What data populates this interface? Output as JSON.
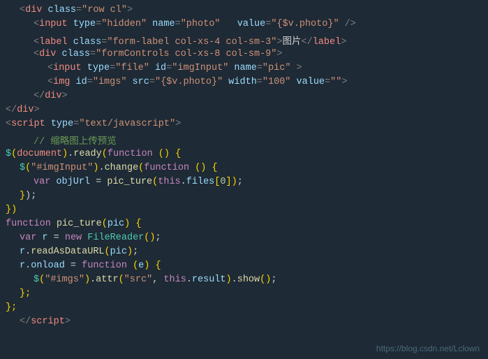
{
  "lines": [
    {
      "indent": 1,
      "tokens": [
        {
          "cls": "c-punct",
          "text": "<"
        },
        {
          "cls": "c-tagname",
          "text": "div"
        },
        {
          "cls": "c-attr",
          "text": " class"
        },
        {
          "cls": "c-punct",
          "text": "="
        },
        {
          "cls": "c-string",
          "text": "\"row cl\""
        },
        {
          "cls": "c-punct",
          "text": ">"
        }
      ]
    },
    {
      "indent": 2,
      "tokens": [
        {
          "cls": "c-punct",
          "text": "<"
        },
        {
          "cls": "c-tagname",
          "text": "input"
        },
        {
          "cls": "c-attr",
          "text": " type"
        },
        {
          "cls": "c-punct",
          "text": "="
        },
        {
          "cls": "c-string",
          "text": "\"hidden\""
        },
        {
          "cls": "c-attr",
          "text": " name"
        },
        {
          "cls": "c-punct",
          "text": "="
        },
        {
          "cls": "c-string",
          "text": "\"photo\""
        },
        {
          "cls": "c-text",
          "text": "   "
        },
        {
          "cls": "c-attr",
          "text": "value"
        },
        {
          "cls": "c-punct",
          "text": "="
        },
        {
          "cls": "c-string",
          "text": "\"{$v.photo}\""
        },
        {
          "cls": "c-text",
          "text": " "
        },
        {
          "cls": "c-punct",
          "text": "/>"
        }
      ]
    },
    {
      "indent": 2,
      "tokens": [
        {
          "cls": "c-punct",
          "text": "<"
        },
        {
          "cls": "c-tagname",
          "text": "label"
        },
        {
          "cls": "c-attr",
          "text": " class"
        },
        {
          "cls": "c-punct",
          "text": "="
        },
        {
          "cls": "c-string",
          "text": "\"form-label col-xs-4 col-sm-3\""
        },
        {
          "cls": "c-punct",
          "text": ">"
        },
        {
          "cls": "c-text",
          "text": "图片"
        },
        {
          "cls": "c-punct",
          "text": "</"
        },
        {
          "cls": "c-tagname",
          "text": "label"
        },
        {
          "cls": "c-punct",
          "text": ">"
        }
      ]
    },
    {
      "indent": 2,
      "tokens": [
        {
          "cls": "c-punct",
          "text": "<"
        },
        {
          "cls": "c-tagname",
          "text": "div"
        },
        {
          "cls": "c-attr",
          "text": " class"
        },
        {
          "cls": "c-punct",
          "text": "="
        },
        {
          "cls": "c-string",
          "text": "\"formControls col-xs-8 col-sm-9\""
        },
        {
          "cls": "c-punct",
          "text": ">"
        }
      ]
    },
    {
      "indent": 3,
      "tokens": [
        {
          "cls": "c-punct",
          "text": "<"
        },
        {
          "cls": "c-tagname",
          "text": "input"
        },
        {
          "cls": "c-attr",
          "text": " type"
        },
        {
          "cls": "c-punct",
          "text": "="
        },
        {
          "cls": "c-string",
          "text": "\"file\""
        },
        {
          "cls": "c-attr",
          "text": " id"
        },
        {
          "cls": "c-punct",
          "text": "="
        },
        {
          "cls": "c-string",
          "text": "\"imgInput\""
        },
        {
          "cls": "c-attr",
          "text": " name"
        },
        {
          "cls": "c-punct",
          "text": "="
        },
        {
          "cls": "c-string",
          "text": "\"pic\""
        },
        {
          "cls": "c-text",
          "text": " "
        },
        {
          "cls": "c-punct",
          "text": ">"
        }
      ]
    },
    {
      "indent": 3,
      "tokens": [
        {
          "cls": "c-punct",
          "text": "<"
        },
        {
          "cls": "c-tagname",
          "text": "img"
        },
        {
          "cls": "c-attr",
          "text": " id"
        },
        {
          "cls": "c-punct",
          "text": "="
        },
        {
          "cls": "c-string",
          "text": "\"imgs\""
        },
        {
          "cls": "c-attr",
          "text": " src"
        },
        {
          "cls": "c-punct",
          "text": "="
        },
        {
          "cls": "c-string",
          "text": "\"{$v.photo}\""
        },
        {
          "cls": "c-attr",
          "text": " width"
        },
        {
          "cls": "c-punct",
          "text": "="
        },
        {
          "cls": "c-string",
          "text": "\"100\""
        },
        {
          "cls": "c-attr",
          "text": " value"
        },
        {
          "cls": "c-punct",
          "text": "="
        },
        {
          "cls": "c-string",
          "text": "\"\""
        },
        {
          "cls": "c-punct",
          "text": ">"
        }
      ]
    },
    {
      "indent": 2,
      "tokens": [
        {
          "cls": "c-punct",
          "text": "</"
        },
        {
          "cls": "c-tagname",
          "text": "div"
        },
        {
          "cls": "c-punct",
          "text": ">"
        }
      ]
    },
    {
      "indent": 0,
      "tokens": [
        {
          "cls": "c-punct",
          "text": "</"
        },
        {
          "cls": "c-tagname",
          "text": "div"
        },
        {
          "cls": "c-punct",
          "text": ">"
        }
      ]
    },
    {
      "indent": 0,
      "tokens": [
        {
          "cls": "c-punct",
          "text": "<"
        },
        {
          "cls": "c-tagname",
          "text": "script"
        },
        {
          "cls": "c-attr",
          "text": " type"
        },
        {
          "cls": "c-punct",
          "text": "="
        },
        {
          "cls": "c-string",
          "text": "\"text/javascript\""
        },
        {
          "cls": "c-punct",
          "text": ">"
        }
      ]
    },
    {
      "indent": 2,
      "tokens": [
        {
          "cls": "c-comment",
          "text": "// 缩略图上传预览"
        }
      ]
    },
    {
      "indent": 0,
      "tokens": [
        {
          "cls": "c-dollar",
          "text": "$"
        },
        {
          "cls": "c-bracket",
          "text": "("
        },
        {
          "cls": "c-tagname",
          "text": "document"
        },
        {
          "cls": "c-bracket",
          "text": ")"
        },
        {
          "cls": "c-text",
          "text": "."
        },
        {
          "cls": "c-method",
          "text": "ready"
        },
        {
          "cls": "c-bracket",
          "text": "("
        },
        {
          "cls": "c-pink",
          "text": "function"
        },
        {
          "cls": "c-text",
          "text": " "
        },
        {
          "cls": "c-bracket",
          "text": "()"
        },
        {
          "cls": "c-text",
          "text": " "
        },
        {
          "cls": "c-bracket",
          "text": "{"
        }
      ]
    },
    {
      "indent": 1,
      "tokens": [
        {
          "cls": "c-dollar",
          "text": "$"
        },
        {
          "cls": "c-bracket",
          "text": "("
        },
        {
          "cls": "c-string",
          "text": "\"#imgInput\""
        },
        {
          "cls": "c-bracket",
          "text": ")"
        },
        {
          "cls": "c-text",
          "text": "."
        },
        {
          "cls": "c-method",
          "text": "change"
        },
        {
          "cls": "c-bracket",
          "text": "("
        },
        {
          "cls": "c-pink",
          "text": "function"
        },
        {
          "cls": "c-text",
          "text": " "
        },
        {
          "cls": "c-bracket",
          "text": "()"
        },
        {
          "cls": "c-text",
          "text": " "
        },
        {
          "cls": "c-bracket",
          "text": "{"
        }
      ]
    },
    {
      "indent": 2,
      "tokens": [
        {
          "cls": "c-pink",
          "text": "var"
        },
        {
          "cls": "c-text",
          "text": " "
        },
        {
          "cls": "c-var",
          "text": "objUrl"
        },
        {
          "cls": "c-text",
          "text": " = "
        },
        {
          "cls": "c-method",
          "text": "pic_ture"
        },
        {
          "cls": "c-bracket",
          "text": "("
        },
        {
          "cls": "c-pink",
          "text": "this"
        },
        {
          "cls": "c-text",
          "text": "."
        },
        {
          "cls": "c-var",
          "text": "files"
        },
        {
          "cls": "c-bracket",
          "text": "["
        },
        {
          "cls": "c-number",
          "text": "0"
        },
        {
          "cls": "c-bracket",
          "text": "]"
        },
        {
          "cls": "c-bracket",
          "text": ")"
        },
        {
          "cls": "c-text",
          "text": ";"
        }
      ]
    },
    {
      "indent": 1,
      "tokens": [
        {
          "cls": "c-bracket",
          "text": "}"
        },
        {
          "cls": "c-text",
          "text": ");"
        }
      ]
    },
    {
      "indent": 0,
      "tokens": [
        {
          "cls": "c-bracket",
          "text": "})"
        }
      ]
    },
    {
      "indent": 0,
      "tokens": [
        {
          "cls": "c-pink",
          "text": "function"
        },
        {
          "cls": "c-text",
          "text": " "
        },
        {
          "cls": "c-method",
          "text": "pic_ture"
        },
        {
          "cls": "c-bracket",
          "text": "("
        },
        {
          "cls": "c-var",
          "text": "pic"
        },
        {
          "cls": "c-bracket",
          "text": ")"
        },
        {
          "cls": "c-text",
          "text": " "
        },
        {
          "cls": "c-bracket",
          "text": "{"
        }
      ]
    },
    {
      "indent": 1,
      "tokens": [
        {
          "cls": "c-pink",
          "text": "var"
        },
        {
          "cls": "c-text",
          "text": " "
        },
        {
          "cls": "c-var",
          "text": "r"
        },
        {
          "cls": "c-text",
          "text": " = "
        },
        {
          "cls": "c-pink",
          "text": "new"
        },
        {
          "cls": "c-text",
          "text": " "
        },
        {
          "cls": "c-teal",
          "text": "FileReader"
        },
        {
          "cls": "c-bracket",
          "text": "()"
        },
        {
          "cls": "c-text",
          "text": ";"
        }
      ]
    },
    {
      "indent": 1,
      "tokens": [
        {
          "cls": "c-var",
          "text": "r"
        },
        {
          "cls": "c-text",
          "text": "."
        },
        {
          "cls": "c-method",
          "text": "readAsDataURL"
        },
        {
          "cls": "c-bracket",
          "text": "("
        },
        {
          "cls": "c-var",
          "text": "pic"
        },
        {
          "cls": "c-bracket",
          "text": ")"
        },
        {
          "cls": "c-text",
          "text": ";"
        }
      ]
    },
    {
      "indent": 1,
      "tokens": [
        {
          "cls": "c-var",
          "text": "r"
        },
        {
          "cls": "c-text",
          "text": "."
        },
        {
          "cls": "c-var",
          "text": "onload"
        },
        {
          "cls": "c-text",
          "text": " = "
        },
        {
          "cls": "c-pink",
          "text": "function"
        },
        {
          "cls": "c-text",
          "text": " "
        },
        {
          "cls": "c-bracket",
          "text": "("
        },
        {
          "cls": "c-var",
          "text": "e"
        },
        {
          "cls": "c-bracket",
          "text": ")"
        },
        {
          "cls": "c-text",
          "text": " "
        },
        {
          "cls": "c-bracket",
          "text": "{"
        }
      ]
    },
    {
      "indent": 2,
      "tokens": [
        {
          "cls": "c-dollar",
          "text": "$"
        },
        {
          "cls": "c-bracket",
          "text": "("
        },
        {
          "cls": "c-string",
          "text": "\"#imgs\""
        },
        {
          "cls": "c-bracket",
          "text": ")"
        },
        {
          "cls": "c-text",
          "text": "."
        },
        {
          "cls": "c-method",
          "text": "attr"
        },
        {
          "cls": "c-bracket",
          "text": "("
        },
        {
          "cls": "c-string",
          "text": "\"src\""
        },
        {
          "cls": "c-text",
          "text": ", "
        },
        {
          "cls": "c-pink",
          "text": "this"
        },
        {
          "cls": "c-text",
          "text": "."
        },
        {
          "cls": "c-var",
          "text": "result"
        },
        {
          "cls": "c-bracket",
          "text": ")"
        },
        {
          "cls": "c-text",
          "text": "."
        },
        {
          "cls": "c-method",
          "text": "show"
        },
        {
          "cls": "c-bracket",
          "text": "()"
        },
        {
          "cls": "c-text",
          "text": ";"
        }
      ]
    },
    {
      "indent": 1,
      "tokens": [
        {
          "cls": "c-bracket",
          "text": "};"
        }
      ]
    },
    {
      "indent": 0,
      "tokens": [
        {
          "cls": "c-bracket",
          "text": "};"
        }
      ]
    },
    {
      "indent": 1,
      "tokens": [
        {
          "cls": "c-punct",
          "text": "</"
        },
        {
          "cls": "c-tagname",
          "text": "script"
        },
        {
          "cls": "c-punct",
          "text": ">"
        }
      ]
    }
  ],
  "watermark": "https://blog.csdn.net/Lclown"
}
